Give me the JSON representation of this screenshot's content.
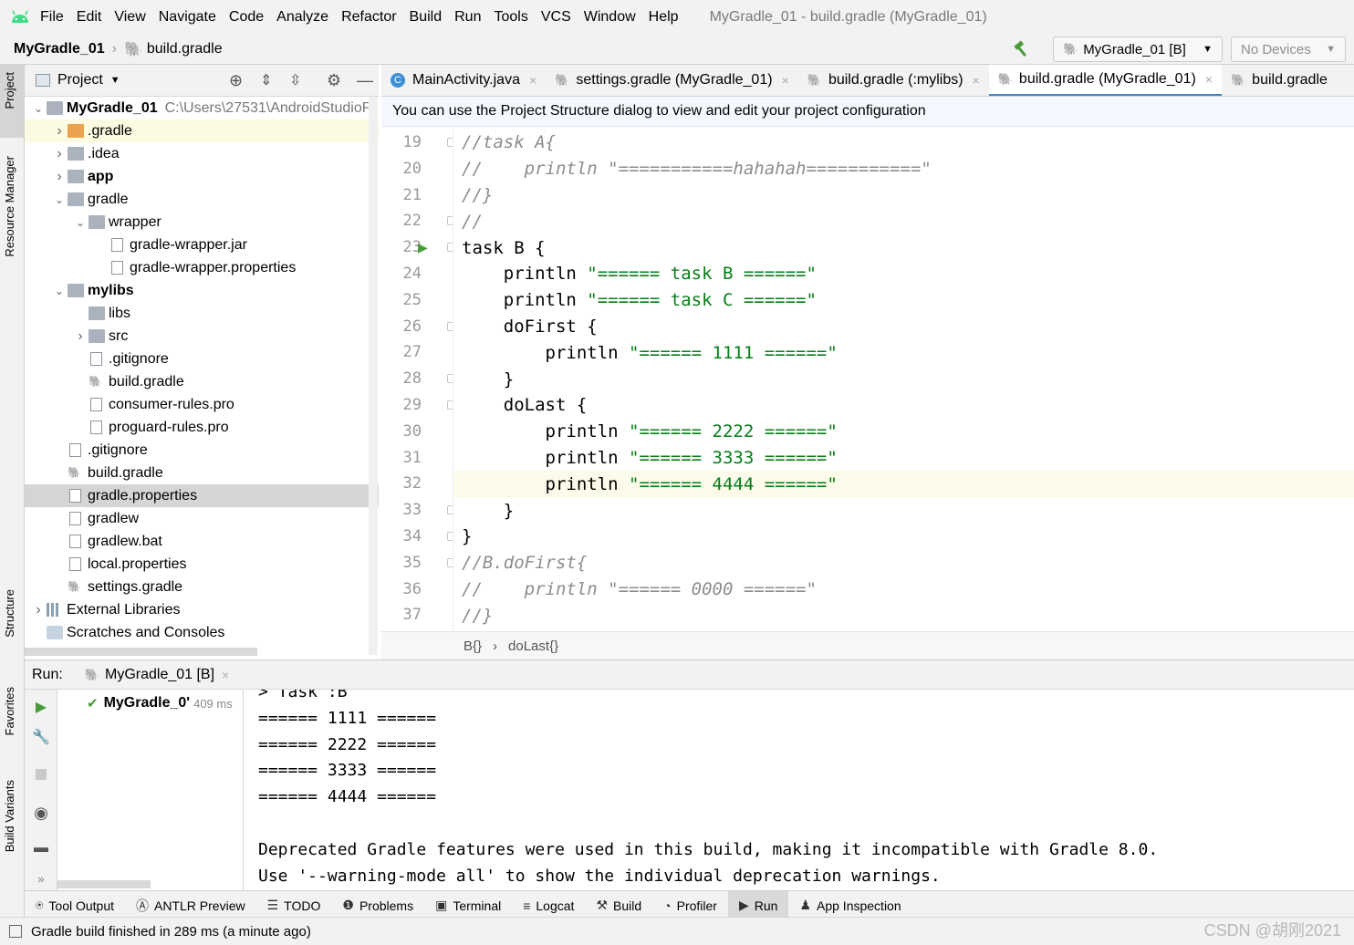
{
  "menubar": {
    "items": [
      "File",
      "Edit",
      "View",
      "Navigate",
      "Code",
      "Analyze",
      "Refactor",
      "Build",
      "Run",
      "Tools",
      "VCS",
      "Window",
      "Help"
    ],
    "title": "MyGradle_01 - build.gradle (MyGradle_01)"
  },
  "navbar": {
    "project": "MyGradle_01",
    "file": "build.gradle",
    "run_config": "MyGradle_01 [B]",
    "device": "No Devices"
  },
  "side_stripe": {
    "project": "Project",
    "resource_manager": "Resource Manager",
    "structure": "Structure",
    "favorites": "Favorites",
    "build_variants": "Build Variants"
  },
  "project_panel": {
    "title": "Project",
    "tree": [
      {
        "label": "MyGradle_01",
        "path": "C:\\Users\\27531\\AndroidStudioP",
        "depth": 0,
        "arrow": "v",
        "icon": "module",
        "bold": true
      },
      {
        "label": ".gradle",
        "depth": 1,
        "arrow": ">",
        "icon": "folder-orange",
        "selected": "light"
      },
      {
        "label": ".idea",
        "depth": 1,
        "arrow": ">",
        "icon": "folder"
      },
      {
        "label": "app",
        "depth": 1,
        "arrow": ">",
        "icon": "folder",
        "bold": true
      },
      {
        "label": "gradle",
        "depth": 1,
        "arrow": "v",
        "icon": "folder"
      },
      {
        "label": "wrapper",
        "depth": 2,
        "arrow": "v",
        "icon": "folder"
      },
      {
        "label": "gradle-wrapper.jar",
        "depth": 3,
        "arrow": "",
        "icon": "file"
      },
      {
        "label": "gradle-wrapper.properties",
        "depth": 3,
        "arrow": "",
        "icon": "file"
      },
      {
        "label": "mylibs",
        "depth": 1,
        "arrow": "v",
        "icon": "module",
        "bold": true
      },
      {
        "label": "libs",
        "depth": 2,
        "arrow": "",
        "icon": "folder"
      },
      {
        "label": "src",
        "depth": 2,
        "arrow": ">",
        "icon": "folder"
      },
      {
        "label": ".gitignore",
        "depth": 2,
        "arrow": "",
        "icon": "file"
      },
      {
        "label": "build.gradle",
        "depth": 2,
        "arrow": "",
        "icon": "gradle"
      },
      {
        "label": "consumer-rules.pro",
        "depth": 2,
        "arrow": "",
        "icon": "file"
      },
      {
        "label": "proguard-rules.pro",
        "depth": 2,
        "arrow": "",
        "icon": "file"
      },
      {
        "label": ".gitignore",
        "depth": 1,
        "arrow": "",
        "icon": "file"
      },
      {
        "label": "build.gradle",
        "depth": 1,
        "arrow": "",
        "icon": "gradle"
      },
      {
        "label": "gradle.properties",
        "depth": 1,
        "arrow": "",
        "icon": "file",
        "selected": "dark"
      },
      {
        "label": "gradlew",
        "depth": 1,
        "arrow": "",
        "icon": "file"
      },
      {
        "label": "gradlew.bat",
        "depth": 1,
        "arrow": "",
        "icon": "file"
      },
      {
        "label": "local.properties",
        "depth": 1,
        "arrow": "",
        "icon": "file"
      },
      {
        "label": "settings.gradle",
        "depth": 1,
        "arrow": "",
        "icon": "gradle"
      },
      {
        "label": "External Libraries",
        "depth": 0,
        "arrow": ">",
        "icon": "library"
      },
      {
        "label": "Scratches and Consoles",
        "depth": 0,
        "arrow": "",
        "icon": "scratch"
      }
    ]
  },
  "editor": {
    "tabs": [
      {
        "label": "MainActivity.java",
        "icon": "java-class-icon"
      },
      {
        "label": "settings.gradle (MyGradle_01)",
        "icon": "gradle-icon"
      },
      {
        "label": "build.gradle (:mylibs)",
        "icon": "gradle-icon"
      },
      {
        "label": "build.gradle (MyGradle_01)",
        "icon": "gradle-icon",
        "active": true
      },
      {
        "label": "build.gradle",
        "icon": "gradle-icon"
      }
    ],
    "info": "You can use the Project Structure dialog to view and edit your project configuration",
    "lines": [
      {
        "n": "19",
        "segs": [
          {
            "t": "//task A{",
            "c": "cm"
          }
        ]
      },
      {
        "n": "20",
        "segs": [
          {
            "t": "//    println \"===========hahahah===========\"",
            "c": "cm"
          }
        ]
      },
      {
        "n": "21",
        "segs": [
          {
            "t": "//}",
            "c": "cm"
          }
        ]
      },
      {
        "n": "22",
        "segs": [
          {
            "t": "//",
            "c": "cm"
          }
        ]
      },
      {
        "n": "23",
        "segs": [
          {
            "t": "task B {",
            "c": ""
          }
        ]
      },
      {
        "n": "24",
        "segs": [
          {
            "t": "    println ",
            "c": ""
          },
          {
            "t": "\"====== task B ======\"",
            "c": "st"
          }
        ]
      },
      {
        "n": "25",
        "segs": [
          {
            "t": "    println ",
            "c": ""
          },
          {
            "t": "\"====== task C ======\"",
            "c": "st"
          }
        ]
      },
      {
        "n": "26",
        "segs": [
          {
            "t": "    doFirst {",
            "c": ""
          }
        ]
      },
      {
        "n": "27",
        "segs": [
          {
            "t": "        println ",
            "c": ""
          },
          {
            "t": "\"====== 1111 ======\"",
            "c": "st"
          }
        ]
      },
      {
        "n": "28",
        "segs": [
          {
            "t": "    }",
            "c": ""
          }
        ]
      },
      {
        "n": "29",
        "segs": [
          {
            "t": "    doLast {",
            "c": ""
          }
        ]
      },
      {
        "n": "30",
        "segs": [
          {
            "t": "        println ",
            "c": ""
          },
          {
            "t": "\"====== 2222 ======\"",
            "c": "st"
          }
        ]
      },
      {
        "n": "31",
        "segs": [
          {
            "t": "        println ",
            "c": ""
          },
          {
            "t": "\"====== 3333 ======\"",
            "c": "st"
          }
        ]
      },
      {
        "n": "32",
        "segs": [
          {
            "t": "        println ",
            "c": ""
          },
          {
            "t": "\"====== 4444 ======\"",
            "c": "st"
          }
        ],
        "highlight": true
      },
      {
        "n": "33",
        "segs": [
          {
            "t": "    }",
            "c": ""
          }
        ]
      },
      {
        "n": "34",
        "segs": [
          {
            "t": "}",
            "c": ""
          }
        ]
      },
      {
        "n": "35",
        "segs": [
          {
            "t": "//B.doFirst{",
            "c": "cm"
          }
        ]
      },
      {
        "n": "36",
        "segs": [
          {
            "t": "//    println \"====== 0000 ======\"",
            "c": "cm"
          }
        ]
      },
      {
        "n": "37",
        "segs": [
          {
            "t": "//}",
            "c": "cm"
          }
        ]
      }
    ],
    "breadcrumb": [
      "B{}",
      "doLast{}"
    ]
  },
  "run": {
    "label": "Run:",
    "tab": "MyGradle_01 [B]",
    "tree_item": "MyGradle_0'",
    "time": "409 ms",
    "console": [
      "> Task :B",
      "====== 1111 ======",
      "====== 2222 ======",
      "====== 3333 ======",
      "====== 4444 ======",
      "",
      "Deprecated Gradle features were used in this build, making it incompatible with Gradle 8.0.",
      "Use '--warning-mode all' to show the individual deprecation warnings."
    ]
  },
  "bottom_tabs": [
    "Tool Output",
    "ANTLR Preview",
    "TODO",
    "Problems",
    "Terminal",
    "Logcat",
    "Build",
    "Profiler",
    "Run",
    "App Inspection"
  ],
  "status": "Gradle build finished in 289 ms (a minute ago)",
  "watermark": "CSDN @胡刚2021"
}
